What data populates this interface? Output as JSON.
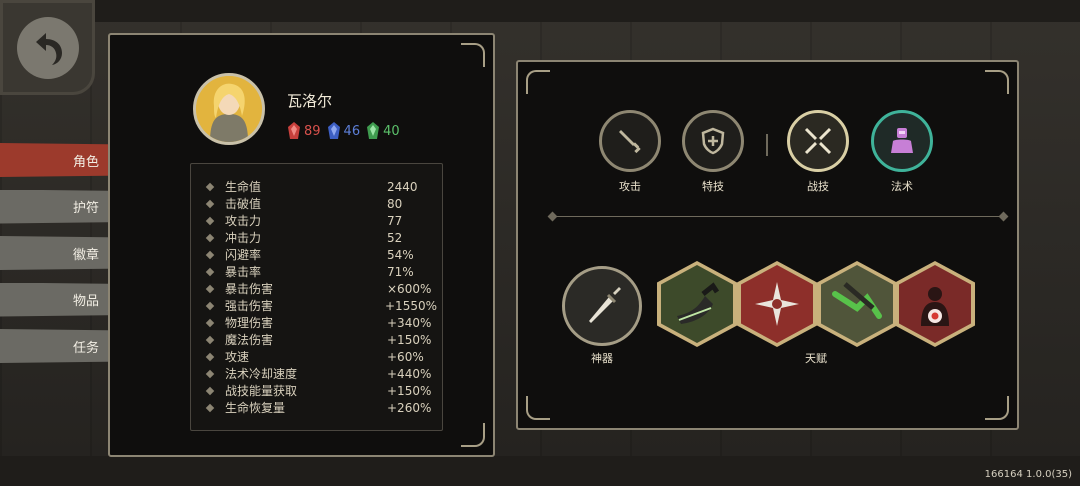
{
  "character": {
    "name": "瓦洛尔",
    "resources": [
      {
        "color": "red",
        "value": "89"
      },
      {
        "color": "blue",
        "value": "46"
      },
      {
        "color": "green",
        "value": "40"
      }
    ]
  },
  "sidebar": {
    "items": [
      {
        "label": "角色",
        "active": true
      },
      {
        "label": "护符",
        "active": false
      },
      {
        "label": "徽章",
        "active": false
      },
      {
        "label": "物品",
        "active": false
      },
      {
        "label": "任务",
        "active": false
      }
    ]
  },
  "stats": [
    {
      "label": "生命值",
      "value": "2440"
    },
    {
      "label": "击破值",
      "value": "80"
    },
    {
      "label": "攻击力",
      "value": "77"
    },
    {
      "label": "冲击力",
      "value": "52"
    },
    {
      "label": "闪避率",
      "value": "54%"
    },
    {
      "label": "暴击率",
      "value": "71%"
    },
    {
      "label": "暴击伤害",
      "value": "×600%"
    },
    {
      "label": "强击伤害",
      "value": "+1550%"
    },
    {
      "label": "物理伤害",
      "value": "+340%"
    },
    {
      "label": "魔法伤害",
      "value": "+150%"
    },
    {
      "label": "攻速",
      "value": "+60%"
    },
    {
      "label": "法术冷却速度",
      "value": "+440%"
    },
    {
      "label": "战技能量获取",
      "value": "+150%"
    },
    {
      "label": "生命恢复量",
      "value": "+260%"
    }
  ],
  "skills": {
    "attack": "攻击",
    "special": "特技",
    "combat": "战技",
    "spell": "法术"
  },
  "loadout": {
    "artifact": "神器",
    "talent": "天赋"
  },
  "colors": {
    "active_tab": "#9c3a2c",
    "inactive_tab": "#6b6a64",
    "spell_ring": "#3fb39a"
  },
  "icons": {
    "back": "back-arrow-icon",
    "attack": "sword-icon",
    "special": "shield-icon",
    "combat": "crossed-blades-icon",
    "spell": "magic-figure-icon"
  },
  "version": "166164 1.0.0(35)"
}
